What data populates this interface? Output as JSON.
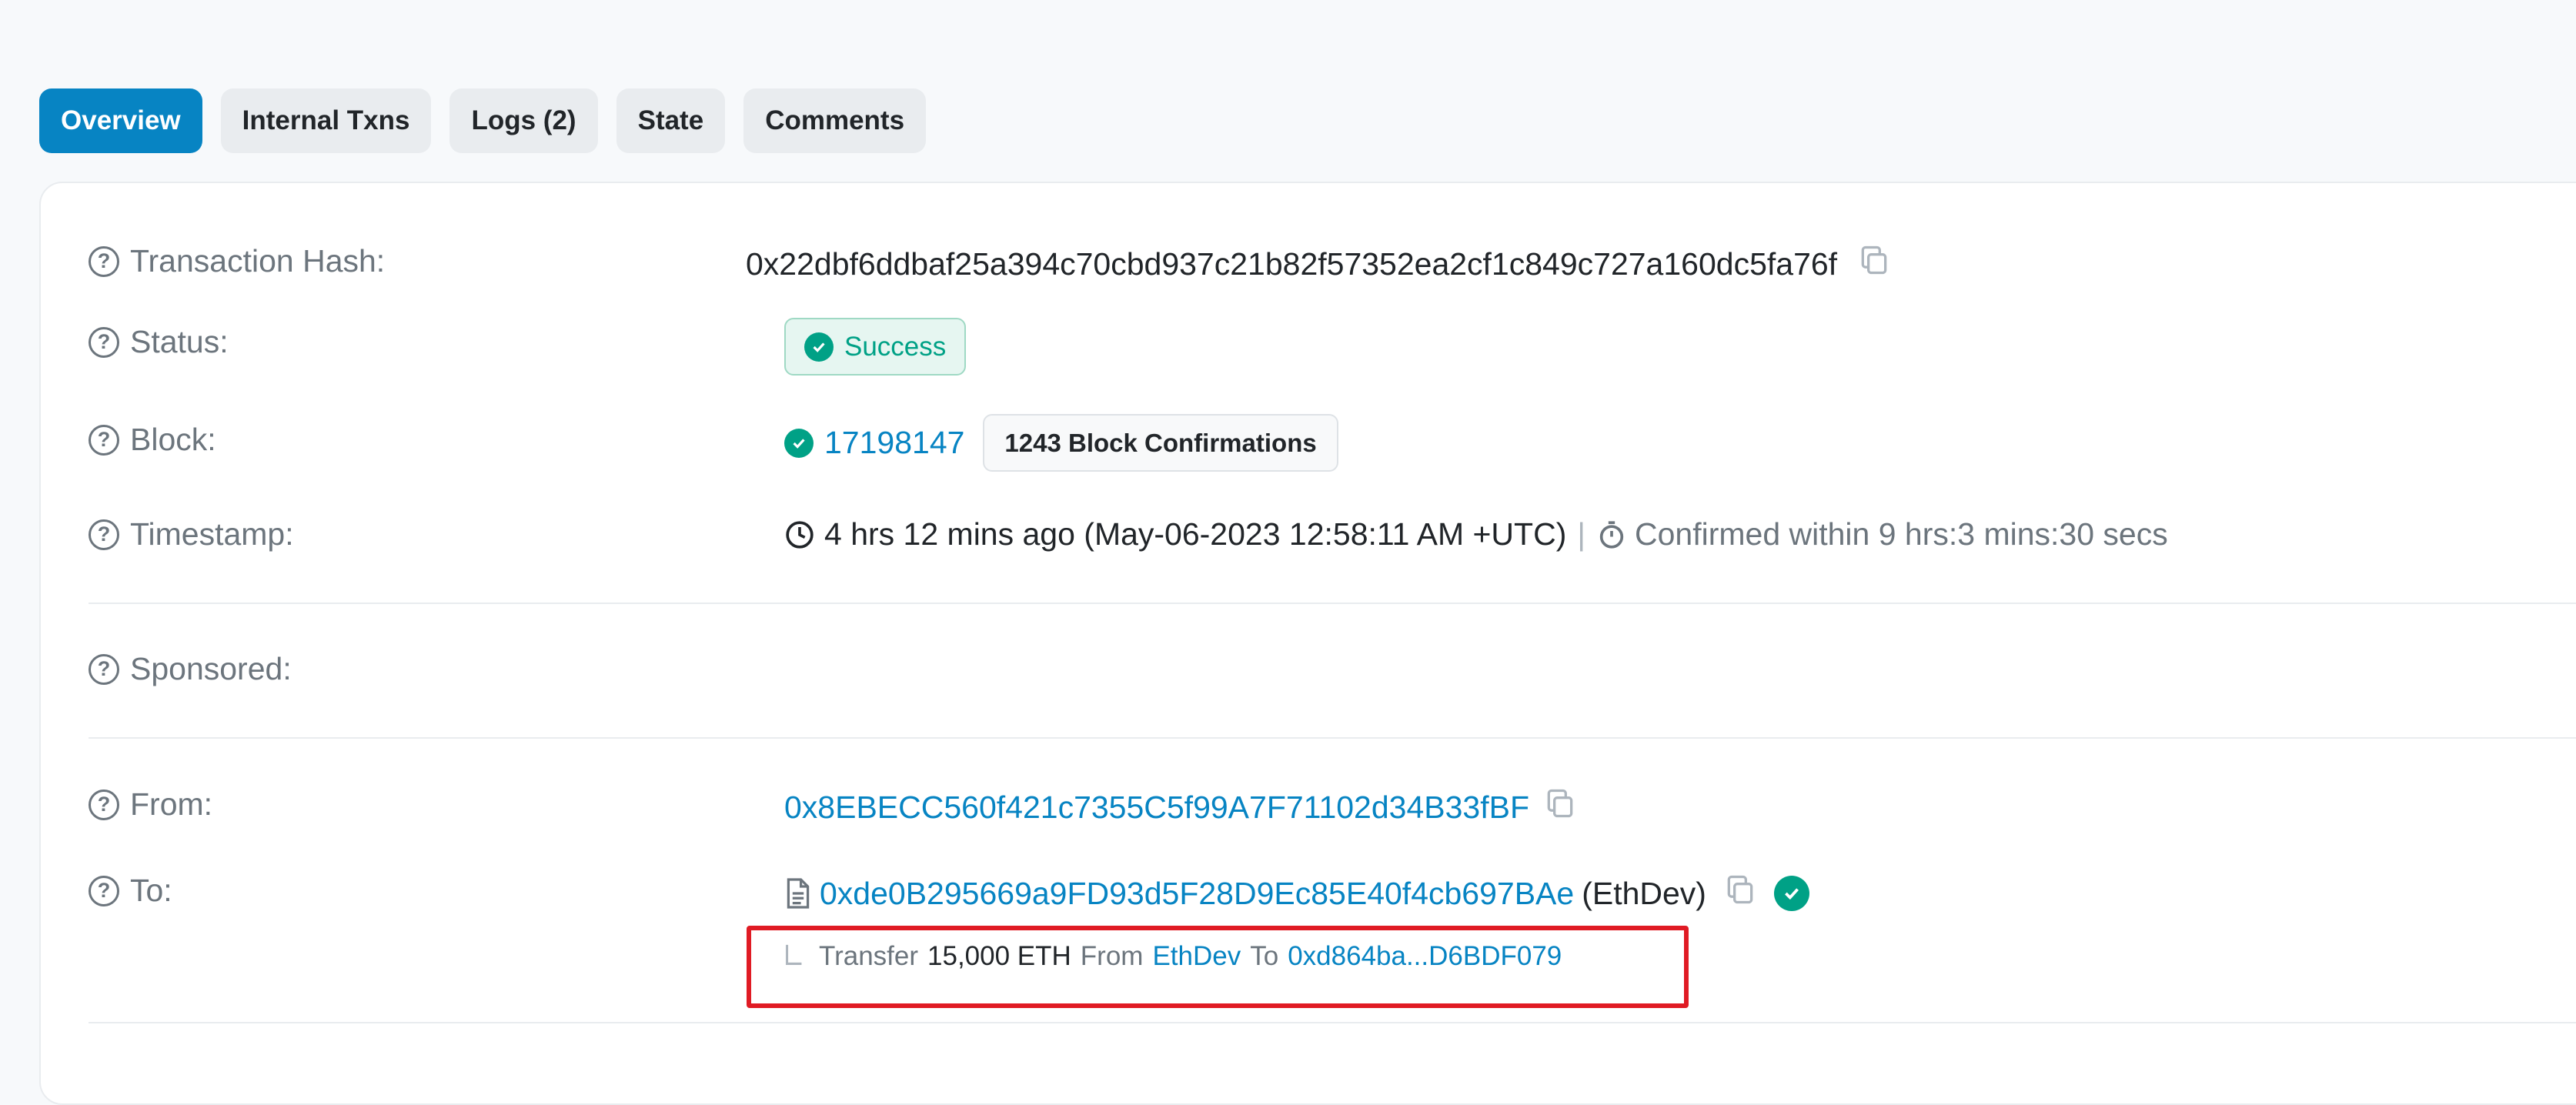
{
  "tabs": [
    {
      "label": "Overview",
      "active": true
    },
    {
      "label": "Internal Txns"
    },
    {
      "label": "Logs (2)"
    },
    {
      "label": "State"
    },
    {
      "label": "Comments"
    }
  ],
  "tx": {
    "hash_label": "Transaction Hash:",
    "hash": "0x22dbf6ddbaf25a394c70cbd937c21b82f57352ea2cf1c849c727a160dc5fa76f",
    "status_label": "Status:",
    "status": "Success",
    "block_label": "Block:",
    "block": "17198147",
    "confirmations": "1243 Block Confirmations",
    "timestamp_label": "Timestamp:",
    "timestamp": "4 hrs 12 mins ago (May-06-2023 12:58:11 AM +UTC)",
    "separator": "|",
    "confirmed_within": "Confirmed within 9 hrs:3 mins:30 secs",
    "sponsored_label": "Sponsored:",
    "from_label": "From:",
    "from": "0x8EBECC560f421c7355C5f99A7F71102d34B33fBF",
    "to_label": "To:",
    "to": "0xde0B295669a9FD93d5F28D9Ec85E40f4cb697BAe",
    "to_name": "(EthDev)"
  },
  "transfer": {
    "word": "Transfer",
    "amount": "15,000 ETH",
    "from_word": "From",
    "from": "EthDev",
    "to_word": "To",
    "to": "0xd864ba...D6BDF079"
  },
  "colors": {
    "accent": "#0784c3",
    "success": "#00a186",
    "highlight": "#e01b24"
  }
}
